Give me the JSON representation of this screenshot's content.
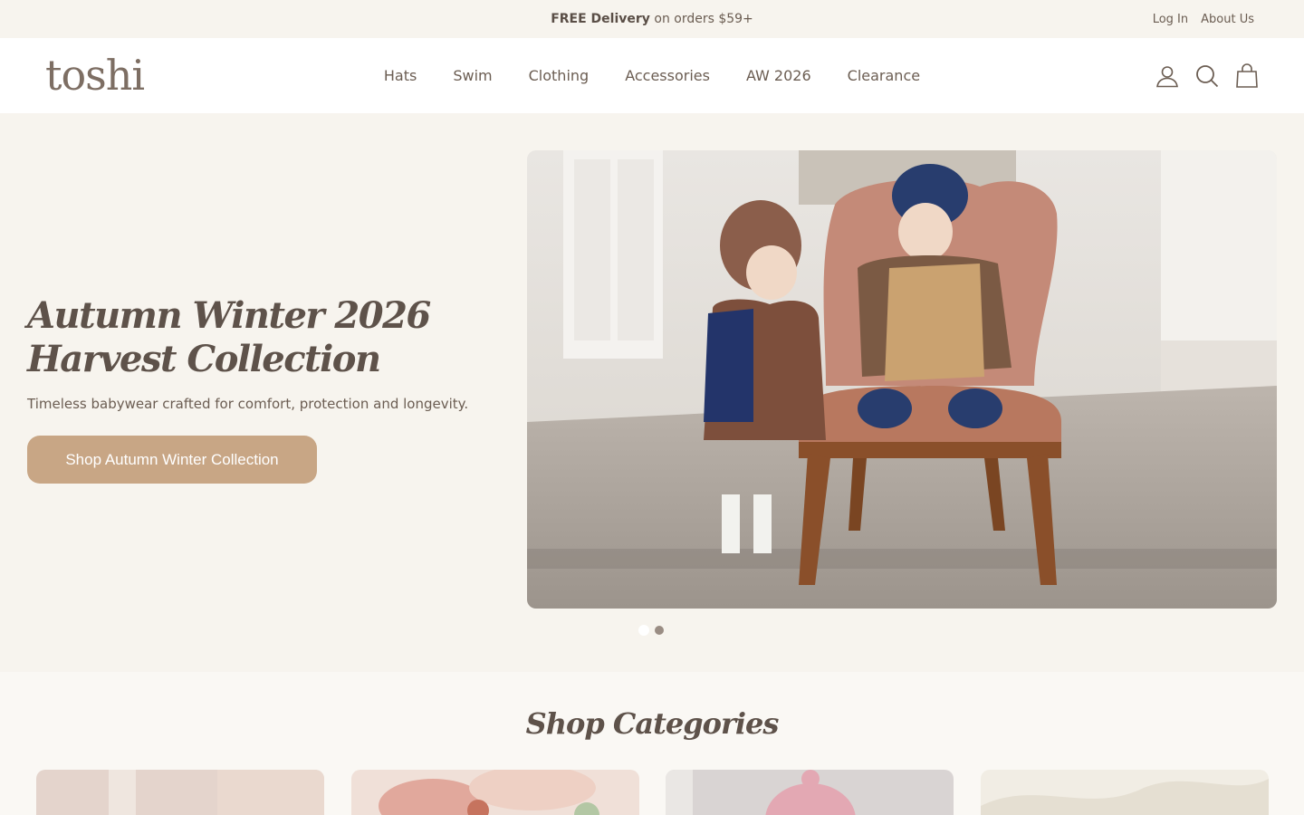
{
  "announcement": {
    "promo_bold": "FREE Delivery",
    "promo_rest": " on orders $59+",
    "login": "Log In",
    "about": "About Us"
  },
  "header": {
    "logo": "toshi",
    "nav": [
      "Hats",
      "Swim",
      "Clothing",
      "Accessories",
      "AW 2026",
      "Clearance"
    ],
    "icons": [
      "account-icon",
      "search-icon",
      "cart-bag-icon"
    ]
  },
  "hero": {
    "title_line1": "Autumn Winter 2026",
    "title_line2": "Harvest Collection",
    "subtitle": "Timeless babywear crafted for comfort, protection and longevity.",
    "cta": "Shop Autumn Winter Collection",
    "slides": 2,
    "active_slide": 2
  },
  "categories": {
    "title": "Shop Categories"
  },
  "colors": {
    "accent": "#c8a685",
    "text": "#6b5d52",
    "background": "#f7f4ee"
  }
}
